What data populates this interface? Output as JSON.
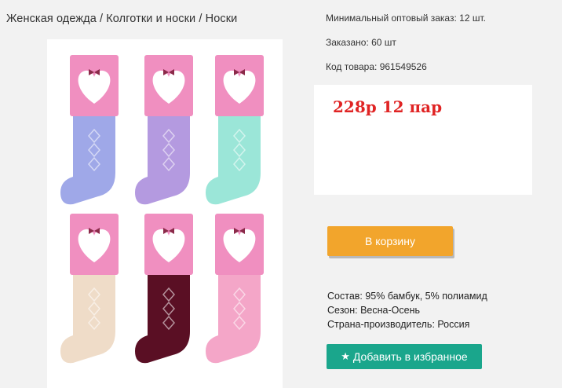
{
  "breadcrumb": "Женская одежда / Колготки и носки / Носки",
  "info": {
    "min_order": "Минимальный оптовый заказ: 12 шт.",
    "ordered": "Заказано: 60 шт",
    "product_code": "Код товара: 961549526"
  },
  "price_text": "228р 12 пар",
  "buttons": {
    "cart": "В корзину",
    "favorite": "Добавить в избранное",
    "favorite_icon": "star-icon"
  },
  "specs": {
    "composition": "Состав: 95% бамбук, 5% полиамид",
    "season": "Сезон: Весна-Осень",
    "country": "Страна-производитель: Россия"
  },
  "product_image": {
    "sock_colors": [
      "#9fa8e8",
      "#b49ae0",
      "#9be6d8",
      "#efdcc8",
      "#5a0f24",
      "#f4a6c8"
    ],
    "label_color": "#f08fc0"
  },
  "colors": {
    "price": "#e02424",
    "cart_button": "#f2a52c",
    "favorite_button": "#1aa68c"
  }
}
